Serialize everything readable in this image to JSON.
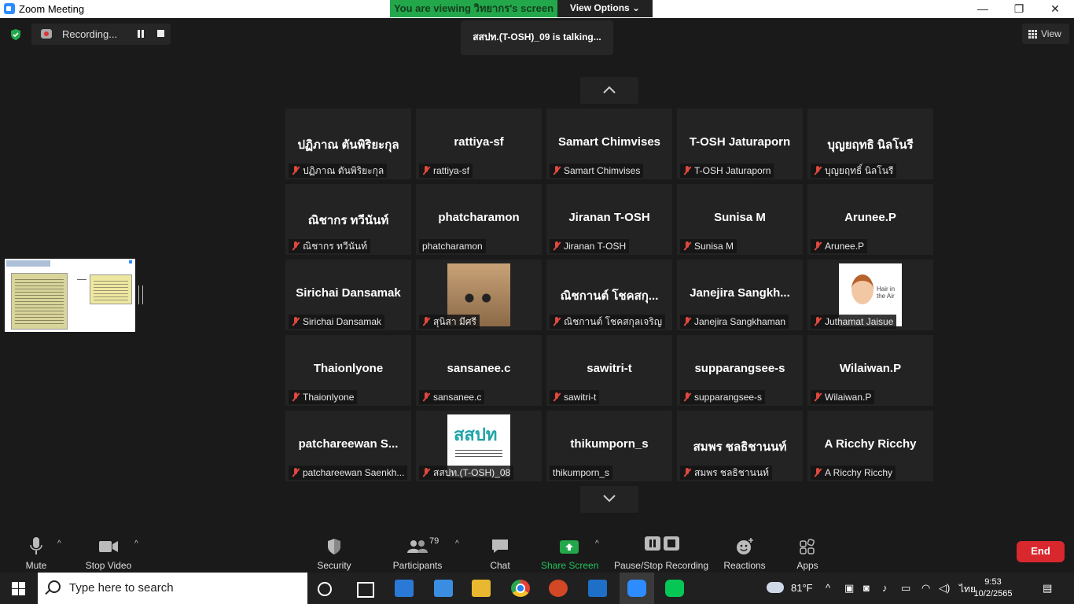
{
  "window": {
    "title": "Zoom Meeting",
    "viewing_banner": "You are viewing วิทยากร's screen",
    "view_options": "View Options ⌄",
    "minimize": "—",
    "restore": "❐",
    "close": "✕"
  },
  "recording": {
    "label": "Recording..."
  },
  "talking": "สสปท.(T-OSH)_09  is  talking...",
  "view_button": "View",
  "tiles": [
    {
      "name": "ปฏิภาณ ตันพิริยะกุล",
      "caption": "ปฏิภาณ ตันพิริยะกุล",
      "muted": true
    },
    {
      "name": "rattiya-sf",
      "caption": "rattiya-sf",
      "muted": true
    },
    {
      "name": "Samart Chimvises",
      "caption": "Samart Chimvises",
      "muted": true
    },
    {
      "name": "T-OSH Jaturaporn",
      "caption": "T-OSH Jaturaporn",
      "muted": true
    },
    {
      "name": "บุญยฤทธิ นิลโนรี",
      "caption": "บุญยฤทธิ์ นิลโนรี",
      "muted": true
    },
    {
      "name": "ณิชากร ทวีนันท์",
      "caption": "ณิชากร ทวีนันท์",
      "muted": true
    },
    {
      "name": "phatcharamon",
      "caption": "phatcharamon",
      "muted": false
    },
    {
      "name": "Jiranan T-OSH",
      "caption": "Jiranan T-OSH",
      "muted": true
    },
    {
      "name": "Sunisa M",
      "caption": "Sunisa M",
      "muted": true
    },
    {
      "name": "Arunee.P",
      "caption": "Arunee.P",
      "muted": true
    },
    {
      "name": "Sirichai Dansamak",
      "caption": "Sirichai Dansamak",
      "muted": true
    },
    {
      "name": "",
      "caption": "สุนิสา มีศรี",
      "muted": true,
      "avatar": "cat"
    },
    {
      "name": "ณิชกานต์ โชคสกุ...",
      "caption": "ณิชกานต์ โชคสกุลเจริญ",
      "muted": true
    },
    {
      "name": "Janejira  Sangkh...",
      "caption": "Janejira Sangkhaman",
      "muted": true
    },
    {
      "name": "",
      "caption": "Juthamat Jaisue",
      "muted": true,
      "avatar": "boy"
    },
    {
      "name": "Thaionlyone",
      "caption": "Thaionlyone",
      "muted": true
    },
    {
      "name": "sansanee.c",
      "caption": "sansanee.c",
      "muted": true
    },
    {
      "name": "sawitri-t",
      "caption": "sawitri-t",
      "muted": true
    },
    {
      "name": "supparangsee-s",
      "caption": "supparangsee-s",
      "muted": true
    },
    {
      "name": "Wilaiwan.P",
      "caption": "Wilaiwan.P",
      "muted": true
    },
    {
      "name": "patchareewan  S...",
      "caption": "patchareewan Saenkh...",
      "muted": true
    },
    {
      "name": "",
      "caption": "สสปท.(T-OSH)_08",
      "muted": true,
      "avatar": "logo"
    },
    {
      "name": "thikumporn_s",
      "caption": "thikumporn_s",
      "muted": false
    },
    {
      "name": "สมพร ชลธิชานนท์",
      "caption": "สมพร ชลธิชานนท์",
      "muted": true
    },
    {
      "name": "A Ricchy Ricchy",
      "caption": "A Ricchy Ricchy",
      "muted": true
    }
  ],
  "toolbar": {
    "mute": "Mute",
    "stop_video": "Stop Video",
    "security": "Security",
    "participants": "Participants",
    "participants_count": "79",
    "chat": "Chat",
    "share_screen": "Share Screen",
    "pause_stop_recording": "Pause/Stop Recording",
    "reactions": "Reactions",
    "apps": "Apps",
    "end": "End"
  },
  "taskbar": {
    "search_placeholder": "Type here to search",
    "temperature": "81°F",
    "language": "ไทย",
    "time": "9:53",
    "date": "10/2/2565"
  },
  "colors": {
    "accent_green": "#22a84a",
    "end_red": "#d8282e",
    "mic_muted_red": "#e0483e",
    "zoom_blue": "#2d8cff"
  }
}
